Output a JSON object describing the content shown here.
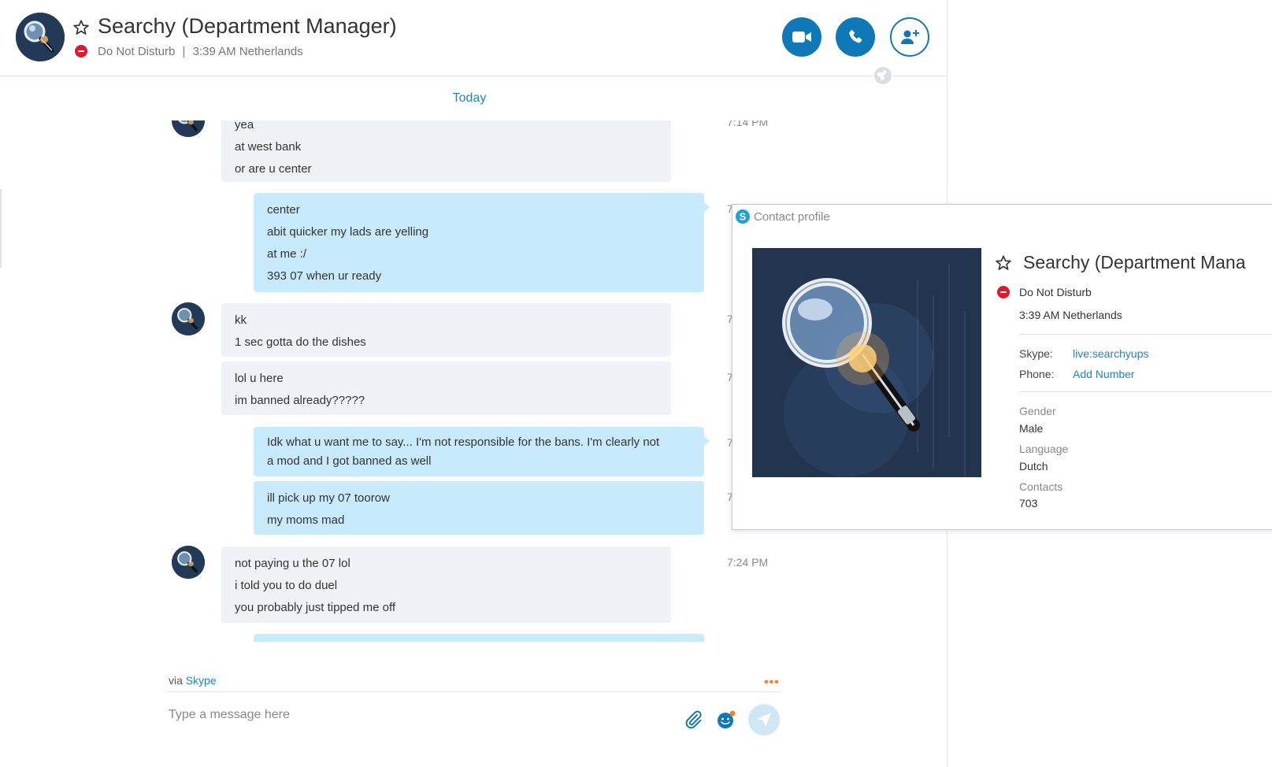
{
  "header": {
    "title": "Searchy (Department Manager)",
    "status": "Do Not Disturb",
    "separator": "|",
    "local_time": "3:39 AM Netherlands"
  },
  "date_divider": "Today",
  "messages": [
    {
      "id": 1,
      "direction": "incoming",
      "lines": [
        "yea",
        "at west bank",
        "or are u center"
      ],
      "timestamp": "7:14 PM"
    },
    {
      "id": 2,
      "direction": "outgoing",
      "lines": [
        "center",
        "abit quicker my lads are yelling",
        "at me :/",
        "393 07 when ur ready"
      ],
      "timestamp": "7"
    },
    {
      "id": 3,
      "direction": "incoming",
      "lines": [
        "kk",
        "1 sec gotta do the dishes"
      ],
      "timestamp": "7"
    },
    {
      "id": 4,
      "direction": "incoming",
      "lines": [
        "lol u here",
        "im banned already?????"
      ],
      "timestamp": "7"
    },
    {
      "id": 5,
      "direction": "outgoing",
      "lines": [
        "Idk what u want me to say... I'm not responsible for the bans. I'm clearly not",
        "a  mod and I got banned as well"
      ],
      "timestamp": "7"
    },
    {
      "id": 6,
      "direction": "outgoing",
      "lines": [
        "ill pick up my 07 toorow",
        "my moms mad"
      ],
      "timestamp": "7"
    },
    {
      "id": 7,
      "direction": "incoming",
      "lines": [
        "not paying u the 07 lol",
        "i told you to do duel",
        "you probably just tipped me off"
      ],
      "timestamp": "7:24 PM"
    }
  ],
  "footer": {
    "via_prefix": "via",
    "via_link": "Skype",
    "more": "•••",
    "compose_placeholder": "Type a message here"
  },
  "profile": {
    "title": "Contact profile",
    "name": "Searchy (Department Mana",
    "status": "Do Not Disturb",
    "local_time": "3:39 AM Netherlands",
    "skype_label": "Skype:",
    "skype_value": "live:searchyups",
    "phone_label": "Phone:",
    "phone_value": "Add Number",
    "gender_label": "Gender",
    "gender_value": "Male",
    "language_label": "Language",
    "language_value": "Dutch",
    "contacts_label": "Contacts",
    "contacts_value": "703"
  },
  "icons": {
    "video": "video-camera-icon",
    "call": "phone-icon",
    "add_people": "add-person-icon",
    "favorite": "star-outline-icon",
    "attach": "paperclip-icon",
    "emoji": "smiley-icon",
    "send": "send-arrow-icon",
    "skype": "skype-logo-icon"
  },
  "colors": {
    "accent": "#0f78b8",
    "link": "#1b86c6",
    "dnd": "#e3162e",
    "incoming_bubble": "#eef2f7",
    "outgoing_bubble": "#c7eafc",
    "more_dots": "#f58220"
  }
}
